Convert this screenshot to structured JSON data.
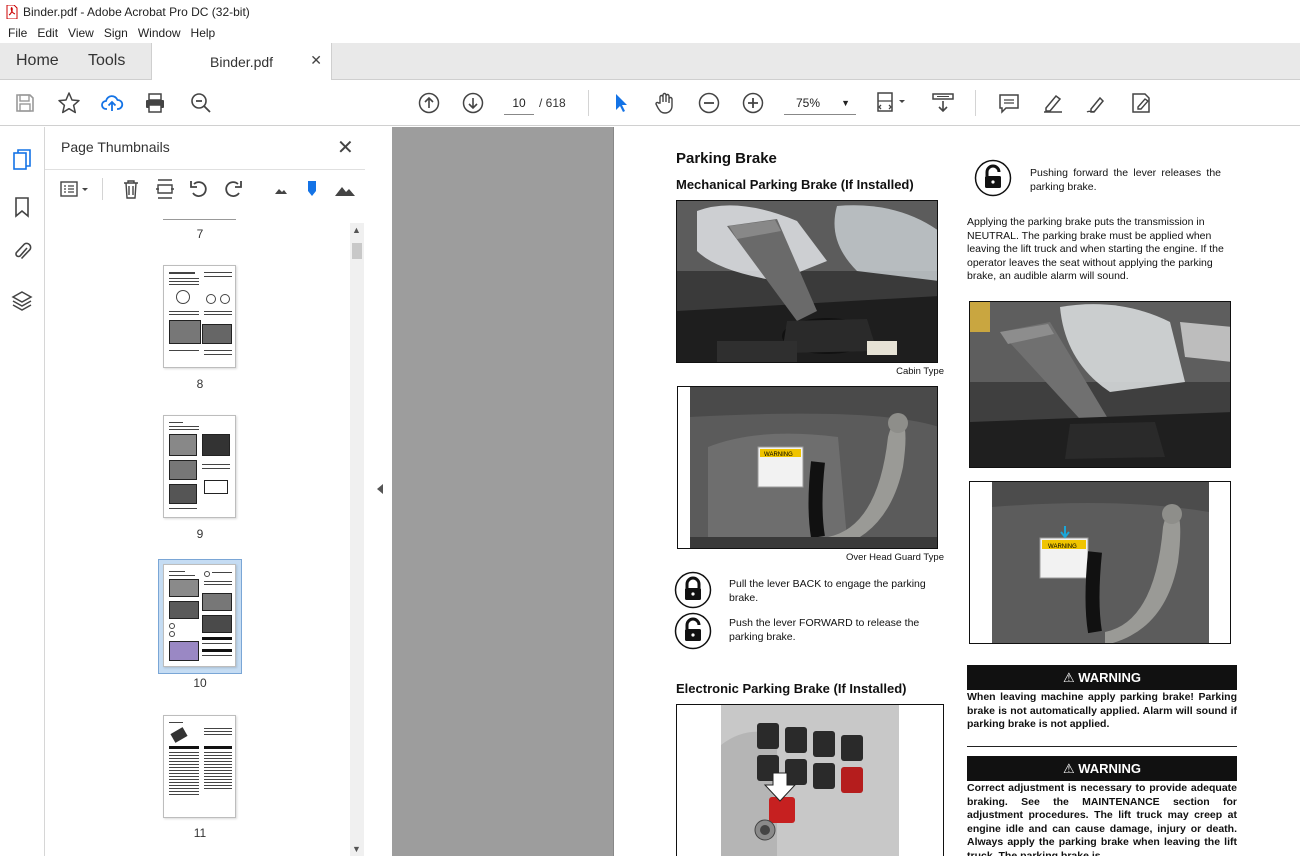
{
  "window": {
    "title": "Binder.pdf - Adobe Acrobat Pro DC (32-bit)"
  },
  "menu": [
    "File",
    "Edit",
    "View",
    "Sign",
    "Window",
    "Help"
  ],
  "tabs": {
    "home": "Home",
    "tools": "Tools",
    "document": "Binder.pdf"
  },
  "toolbar": {
    "page_current": "10",
    "page_total": "/ 618",
    "zoom": "75%"
  },
  "thumbnails": {
    "title": "Page Thumbnails",
    "pages": [
      {
        "label": "7"
      },
      {
        "label": "8"
      },
      {
        "label": "9"
      },
      {
        "label": "10",
        "selected": true
      },
      {
        "label": "11"
      }
    ]
  },
  "document": {
    "heading": "Parking Brake",
    "sub_mechanical": "Mechanical Parking Brake (If Installed)",
    "caption_cabin": "Cabin Type",
    "caption_ohg": "Over Head Guard Type",
    "pull_back": "Pull the lever BACK to engage the parking brake.",
    "push_forward": "Push the lever FORWARD to release the parking brake.",
    "sub_electronic": "Electronic Parking Brake (If Installed)",
    "pushing_forward": "Pushing forward the lever releases the parking brake.",
    "applying": "Applying the parking brake puts the transmission in NEUTRAL. The parking brake must be applied when leaving the lift truck and when starting the engine. If the operator leaves the seat without applying the parking brake, an audible alarm will sound.",
    "warning1_title": "WARNING",
    "warning1_text": "When leaving machine apply parking brake! Parking brake is not automatically applied. Alarm will sound if parking brake is not applied.",
    "warning2_title": "WARNING",
    "warning2_text": "Correct adjustment is necessary to provide adequate braking. See the MAINTENANCE section for adjustment procedures. The lift truck may creep at engine idle and can cause damage, injury or death. Always apply the parking brake when leaving the lift truck. The parking brake is",
    "label_warning_sticker": "WARNING"
  }
}
